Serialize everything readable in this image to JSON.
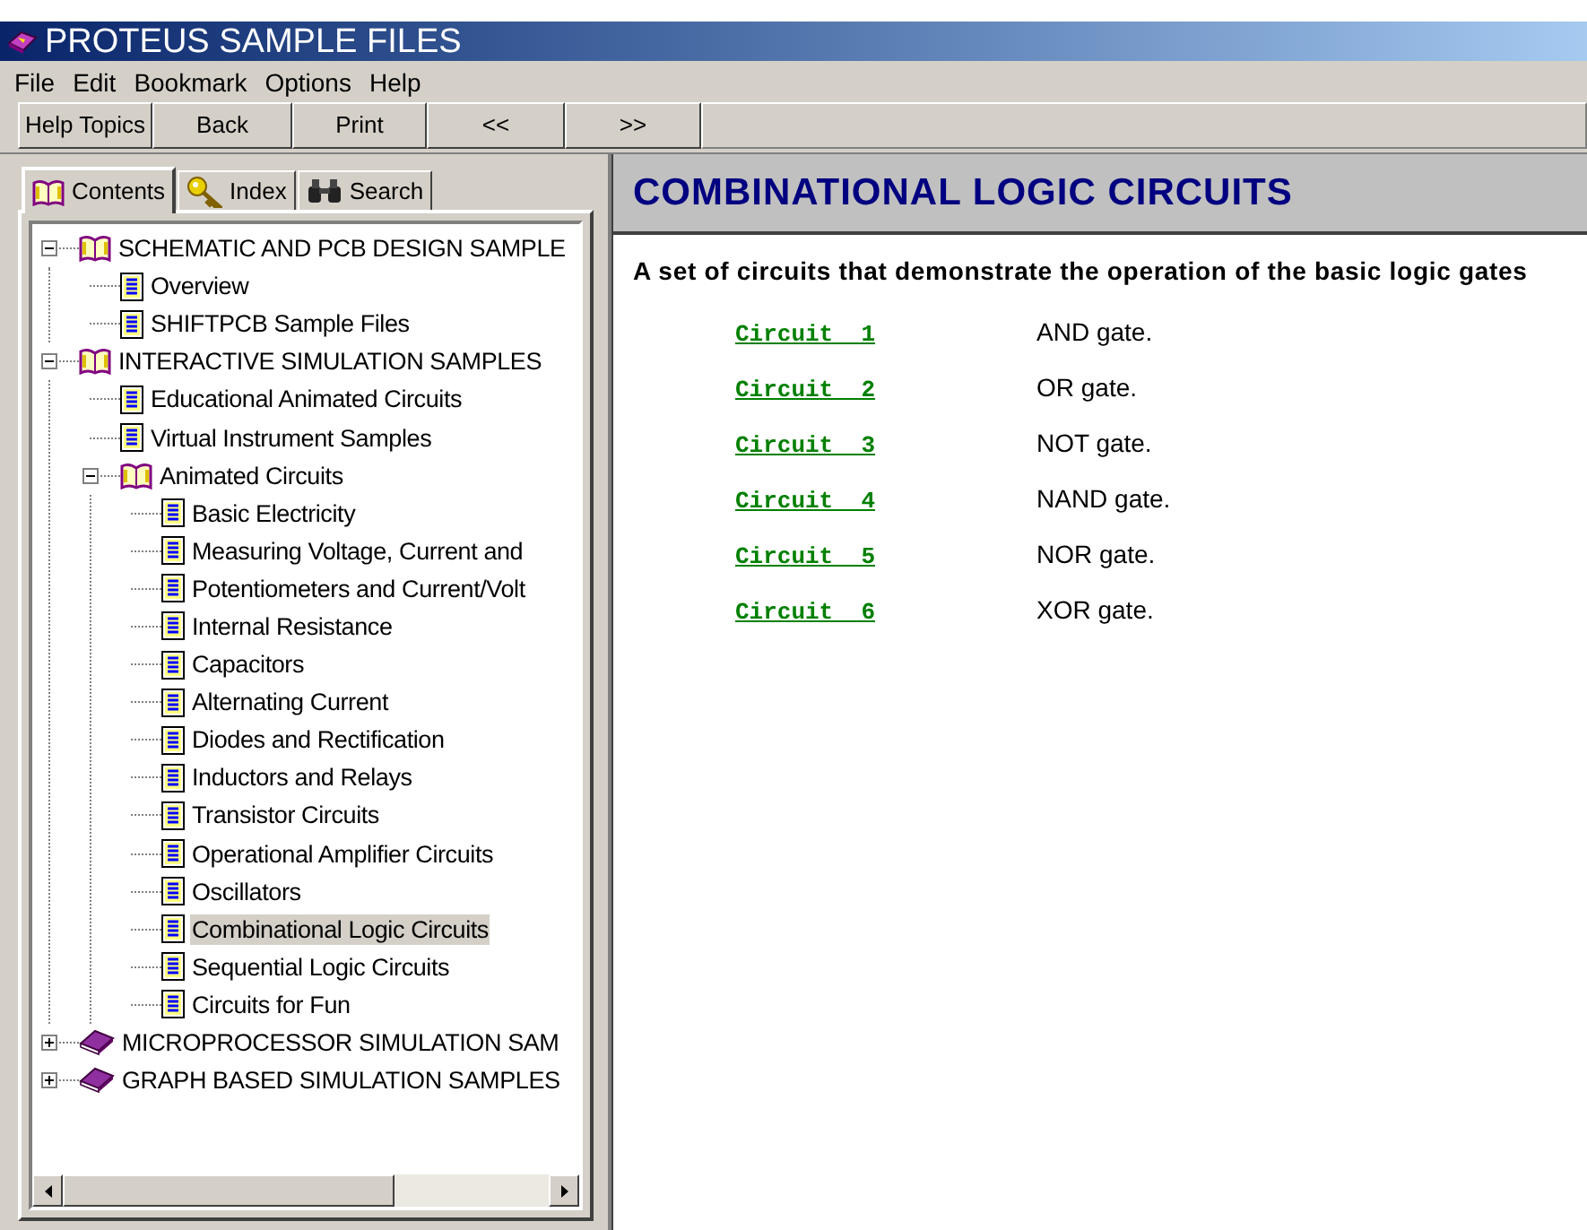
{
  "window": {
    "title": "PROTEUS SAMPLE FILES"
  },
  "menu": [
    {
      "label": "File"
    },
    {
      "label": "Edit"
    },
    {
      "label": "Bookmark"
    },
    {
      "label": "Options"
    },
    {
      "label": "Help"
    }
  ],
  "toolbar": [
    {
      "label": "Help Topics"
    },
    {
      "label": "Back"
    },
    {
      "label": "Print"
    },
    {
      "label": "<<"
    },
    {
      "label": ">>"
    }
  ],
  "tabs": [
    {
      "label": "Contents",
      "kind": "book",
      "selected": true
    },
    {
      "label": "Index",
      "kind": "key",
      "selected": false
    },
    {
      "label": "Search",
      "kind": "binoculars",
      "selected": false
    }
  ],
  "tree": [
    {
      "kind": "book",
      "label": "SCHEMATIC AND PCB DESIGN SAMPLE",
      "expanded": true,
      "selected": false,
      "children": [
        {
          "kind": "page",
          "label": "Overview",
          "selected": false
        },
        {
          "kind": "page",
          "label": "SHIFTPCB Sample Files",
          "selected": false
        }
      ]
    },
    {
      "kind": "book",
      "label": "INTERACTIVE SIMULATION SAMPLES",
      "expanded": true,
      "selected": false,
      "children": [
        {
          "kind": "page",
          "label": "Educational Animated Circuits",
          "selected": false
        },
        {
          "kind": "page",
          "label": "Virtual Instrument Samples",
          "selected": false
        },
        {
          "kind": "book",
          "label": "Animated Circuits",
          "expanded": true,
          "selected": false,
          "children": [
            {
              "kind": "page",
              "label": "Basic Electricity",
              "selected": false
            },
            {
              "kind": "page",
              "label": "Measuring Voltage, Current and",
              "selected": false
            },
            {
              "kind": "page",
              "label": "Potentiometers and Current/Volt",
              "selected": false
            },
            {
              "kind": "page",
              "label": "Internal Resistance",
              "selected": false
            },
            {
              "kind": "page",
              "label": "Capacitors",
              "selected": false
            },
            {
              "kind": "page",
              "label": "Alternating Current",
              "selected": false
            },
            {
              "kind": "page",
              "label": "Diodes and Rectification",
              "selected": false
            },
            {
              "kind": "page",
              "label": "Inductors and Relays",
              "selected": false
            },
            {
              "kind": "page",
              "label": "Transistor Circuits",
              "selected": false
            },
            {
              "kind": "page",
              "label": "Operational Amplifier Circuits",
              "selected": false
            },
            {
              "kind": "page",
              "label": "Oscillators",
              "selected": false
            },
            {
              "kind": "page",
              "label": "Combinational Logic Circuits",
              "selected": true
            },
            {
              "kind": "page",
              "label": "Sequential Logic Circuits",
              "selected": false
            },
            {
              "kind": "page",
              "label": "Circuits for Fun",
              "selected": false
            }
          ]
        }
      ]
    },
    {
      "kind": "book",
      "label": "MICROPROCESSOR SIMULATION SAM",
      "expanded": false,
      "selected": false
    },
    {
      "kind": "book",
      "label": "GRAPH BASED SIMULATION SAMPLES",
      "expanded": false,
      "selected": false
    }
  ],
  "content": {
    "heading": "COMBINATIONAL LOGIC CIRCUITS",
    "intro": "A set of circuits that demonstrate the operation of the basic logic gates",
    "circuits": [
      {
        "link": "Circuit 1",
        "description": "AND gate."
      },
      {
        "link": "Circuit 2",
        "description": "OR gate."
      },
      {
        "link": "Circuit 3",
        "description": "NOT gate."
      },
      {
        "link": "Circuit 4",
        "description": "NAND gate."
      },
      {
        "link": "Circuit 5",
        "description": "NOR gate."
      },
      {
        "link": "Circuit 6",
        "description": "XOR gate."
      }
    ]
  }
}
